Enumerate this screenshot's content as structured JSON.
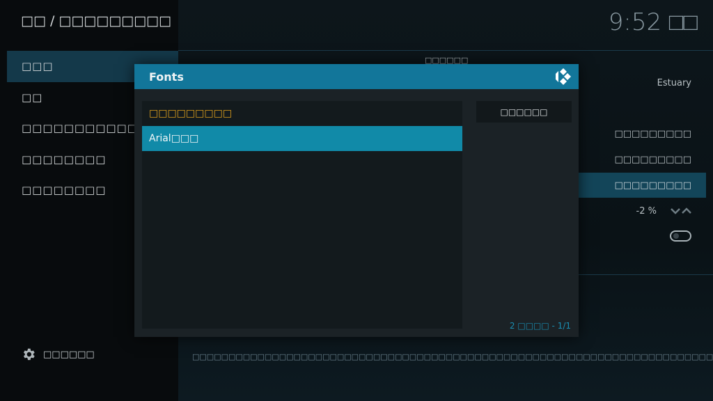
{
  "header": {
    "breadcrumb": "□□ / □□□□□□□□□",
    "clock": "9:52 □□"
  },
  "sidebar": {
    "items": [
      {
        "label": "□□□"
      },
      {
        "label": "□□"
      },
      {
        "label": "□□□□□□□□□□□"
      },
      {
        "label": "□□□□□□□□"
      },
      {
        "label": "□□□□□□□□"
      }
    ],
    "footer_label": "□□□□□□"
  },
  "settings": {
    "category_title": "□□□□□□",
    "skin_value": "Estuary",
    "row2_value": "□□□□□□□□□",
    "row3_value": "□□□□□□□□□",
    "row4_value": "□□□□□□□□□",
    "zoom_value": "-2 %",
    "description": "□□□□□□□□□□□□□□□□□□□□□□□□□□□□□□□□□□□□□□□□□□□□□□□□□□□□□□□□□□□□□□□□□□□□□□□□□□□□□□□□□□□□□□□□□□□□□□"
  },
  "dialog": {
    "title": "Fonts",
    "items": [
      {
        "label": "□□□□□□□□□",
        "state": "current"
      },
      {
        "label": "Arial□□□",
        "state": "selected"
      }
    ],
    "button_label": "□□□□□□",
    "counter": "2 □□□□ - 1/1"
  },
  "colors": {
    "accent": "#12769a",
    "selected": "#118aa8",
    "current_item": "#e2a21c"
  }
}
